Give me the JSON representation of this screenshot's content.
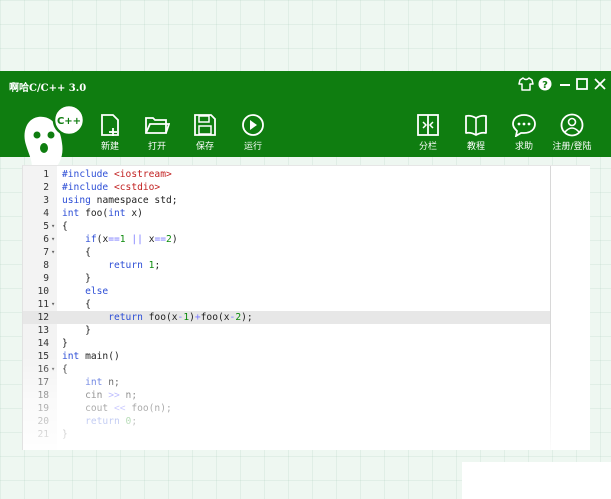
{
  "window": {
    "title": "啊哈C/C++ 3.0"
  },
  "toolbar": {
    "new_label": "新建",
    "open_label": "打开",
    "save_label": "保存",
    "run_label": "运行",
    "split_label": "分栏",
    "tutorial_label": "教程",
    "help_label": "求助",
    "login_label": "注册/登陆"
  },
  "mascot": {
    "badge_text": "C++"
  },
  "editor": {
    "active_line": 12,
    "lines": [
      {
        "num": "1",
        "fold": false,
        "html": "<span class=\"pp\">#include</span> <span class=\"st\">&lt;iostream&gt;</span>"
      },
      {
        "num": "2",
        "fold": false,
        "html": "<span class=\"pp\">#include</span> <span class=\"st\">&lt;cstdio&gt;</span>"
      },
      {
        "num": "3",
        "fold": false,
        "html": "<span class=\"kw\">using</span> namespace std;"
      },
      {
        "num": "4",
        "fold": false,
        "html": "<span class=\"kw\">int</span> foo(<span class=\"kw\">int</span> x)"
      },
      {
        "num": "5",
        "fold": true,
        "html": "{"
      },
      {
        "num": "6",
        "fold": true,
        "html": "    <span class=\"kw\">if</span>(x<span class=\"op\">==</span><span class=\"nm\">1</span> <span class=\"op\">||</span> x<span class=\"op\">==</span><span class=\"nm\">2</span>)"
      },
      {
        "num": "7",
        "fold": true,
        "html": "    {"
      },
      {
        "num": "8",
        "fold": false,
        "html": "        <span class=\"kw\">return</span> <span class=\"nm\">1</span>;"
      },
      {
        "num": "9",
        "fold": false,
        "html": "    }"
      },
      {
        "num": "10",
        "fold": false,
        "html": "    <span class=\"kw\">else</span>"
      },
      {
        "num": "11",
        "fold": true,
        "html": "    {"
      },
      {
        "num": "12",
        "fold": false,
        "html": "        <span class=\"kw\">return</span> foo(x<span class=\"op\">-</span><span class=\"nm\">1</span>)<span class=\"op\">+</span>foo(x<span class=\"op\">-</span><span class=\"nm\">2</span>);"
      },
      {
        "num": "13",
        "fold": false,
        "html": "    }"
      },
      {
        "num": "14",
        "fold": false,
        "html": "}"
      },
      {
        "num": "15",
        "fold": false,
        "html": "<span class=\"kw\">int</span> main()"
      },
      {
        "num": "16",
        "fold": true,
        "html": "{"
      },
      {
        "num": "17",
        "fold": false,
        "html": "    <span class=\"kw\">int</span> n;"
      },
      {
        "num": "18",
        "fold": false,
        "html": "    cin <span class=\"op\">&gt;&gt;</span> n;"
      },
      {
        "num": "19",
        "fold": false,
        "html": "    cout <span class=\"op\">&lt;&lt;</span> foo(n);"
      },
      {
        "num": "20",
        "fold": false,
        "html": "    <span class=\"kw\">return</span> <span class=\"nm\">0</span>;"
      },
      {
        "num": "21",
        "fold": false,
        "html": "}"
      }
    ]
  },
  "colors": {
    "titlebar": "#0f7d10",
    "keyword": "#2e4fd6",
    "string": "#c22222",
    "number": "#0b8a0b"
  }
}
